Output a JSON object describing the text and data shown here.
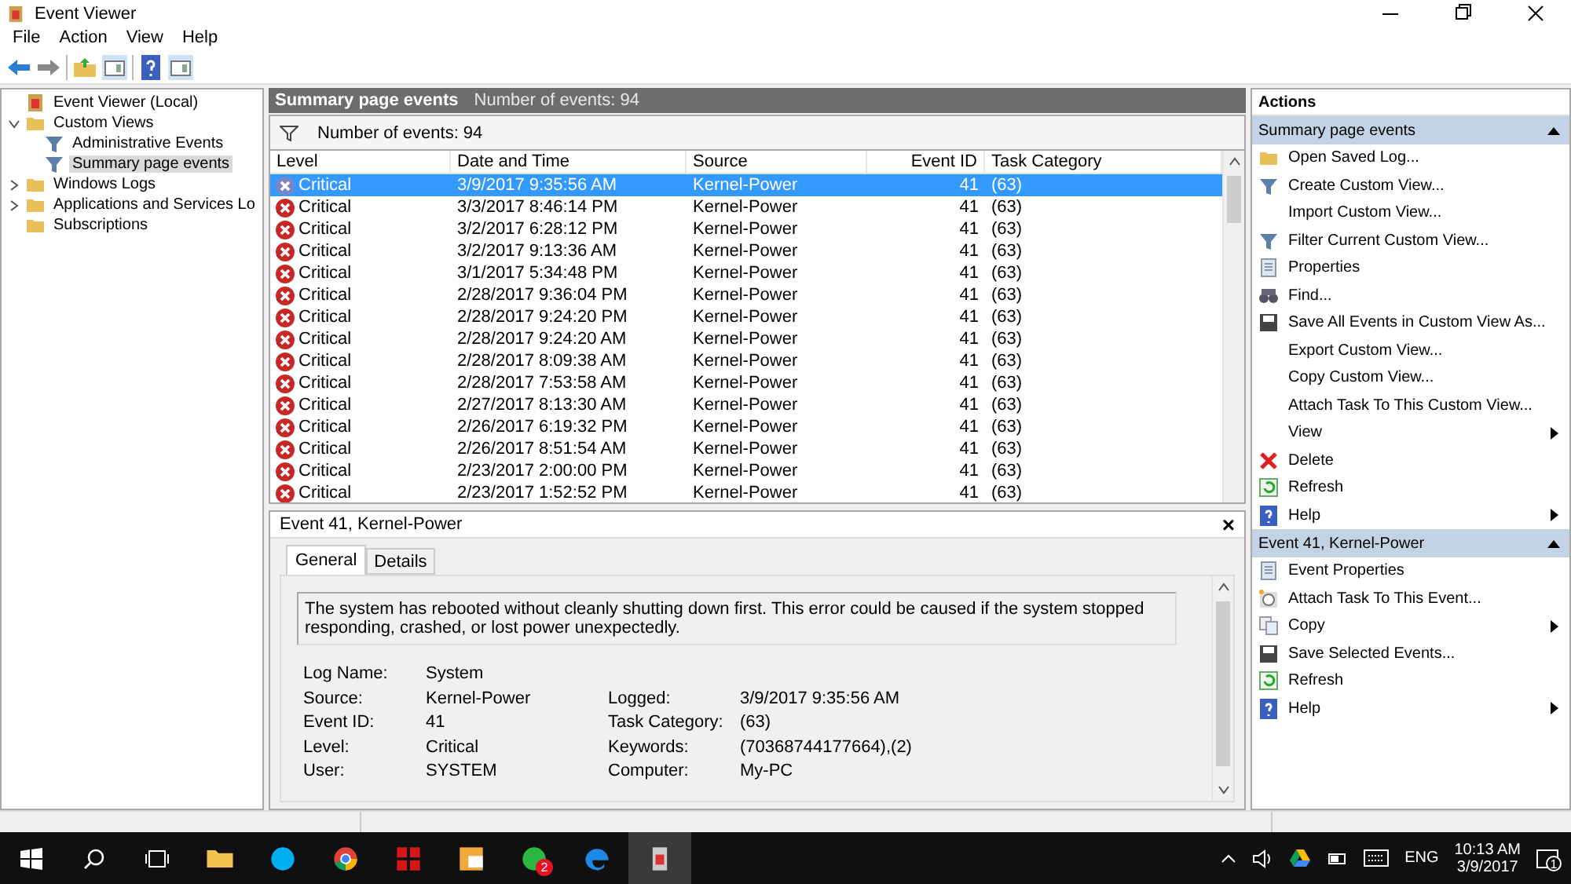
{
  "window": {
    "title": "Event Viewer"
  },
  "menu": [
    "File",
    "Action",
    "View",
    "Help"
  ],
  "toolbar": [
    {
      "kind": "back"
    },
    {
      "kind": "forward"
    },
    {
      "kind": "sep"
    },
    {
      "kind": "up"
    },
    {
      "kind": "pane"
    },
    {
      "kind": "sep"
    },
    {
      "kind": "help"
    },
    {
      "kind": "pane"
    }
  ],
  "tree": [
    {
      "label": "Event Viewer (Local)",
      "kind": "root",
      "selected": false,
      "children": [
        {
          "label": "Custom Views",
          "kind": "folder",
          "expanded": true,
          "selected": false,
          "children": [
            {
              "label": "Administrative Events",
              "kind": "filter",
              "selected": false
            },
            {
              "label": "Summary page events",
              "kind": "filter",
              "selected": true
            }
          ]
        },
        {
          "label": "Windows Logs",
          "kind": "folder",
          "expanded": false,
          "selected": false
        },
        {
          "label": "Applications and Services Lo",
          "kind": "folder",
          "expanded": false,
          "selected": false
        },
        {
          "label": "Subscriptions",
          "kind": "folder",
          "selected": false
        }
      ]
    }
  ],
  "header": {
    "title": "Summary page events",
    "count": "Number of events: 94"
  },
  "filter_bar": {
    "text": "Number of events: 94"
  },
  "table": {
    "columns": [
      "Level",
      "Date and Time",
      "Source",
      "Event ID",
      "Task Category"
    ],
    "rows": [
      {
        "level": "Critical",
        "date": "3/9/2017 9:35:56 AM",
        "source": "Kernel-Power",
        "id": "41",
        "category": "(63)",
        "selected": true
      },
      {
        "level": "Critical",
        "date": "3/3/2017 8:46:14 PM",
        "source": "Kernel-Power",
        "id": "41",
        "category": "(63)",
        "selected": false
      },
      {
        "level": "Critical",
        "date": "3/2/2017 6:28:12 PM",
        "source": "Kernel-Power",
        "id": "41",
        "category": "(63)",
        "selected": false
      },
      {
        "level": "Critical",
        "date": "3/2/2017 9:13:36 AM",
        "source": "Kernel-Power",
        "id": "41",
        "category": "(63)",
        "selected": false
      },
      {
        "level": "Critical",
        "date": "3/1/2017 5:34:48 PM",
        "source": "Kernel-Power",
        "id": "41",
        "category": "(63)",
        "selected": false
      },
      {
        "level": "Critical",
        "date": "2/28/2017 9:36:04 PM",
        "source": "Kernel-Power",
        "id": "41",
        "category": "(63)",
        "selected": false
      },
      {
        "level": "Critical",
        "date": "2/28/2017 9:24:20 PM",
        "source": "Kernel-Power",
        "id": "41",
        "category": "(63)",
        "selected": false
      },
      {
        "level": "Critical",
        "date": "2/28/2017 9:24:20 AM",
        "source": "Kernel-Power",
        "id": "41",
        "category": "(63)",
        "selected": false
      },
      {
        "level": "Critical",
        "date": "2/28/2017 8:09:38 AM",
        "source": "Kernel-Power",
        "id": "41",
        "category": "(63)",
        "selected": false
      },
      {
        "level": "Critical",
        "date": "2/28/2017 7:53:58 AM",
        "source": "Kernel-Power",
        "id": "41",
        "category": "(63)",
        "selected": false
      },
      {
        "level": "Critical",
        "date": "2/27/2017 8:13:30 AM",
        "source": "Kernel-Power",
        "id": "41",
        "category": "(63)",
        "selected": false
      },
      {
        "level": "Critical",
        "date": "2/26/2017 6:19:32 PM",
        "source": "Kernel-Power",
        "id": "41",
        "category": "(63)",
        "selected": false
      },
      {
        "level": "Critical",
        "date": "2/26/2017 8:51:54 AM",
        "source": "Kernel-Power",
        "id": "41",
        "category": "(63)",
        "selected": false
      },
      {
        "level": "Critical",
        "date": "2/23/2017 2:00:00 PM",
        "source": "Kernel-Power",
        "id": "41",
        "category": "(63)",
        "selected": false
      },
      {
        "level": "Critical",
        "date": "2/23/2017 1:52:52 PM",
        "source": "Kernel-Power",
        "id": "41",
        "category": "(63)",
        "selected": false
      }
    ]
  },
  "details": {
    "title": "Event 41, Kernel-Power",
    "close": "×",
    "tabs": [
      {
        "label": "General",
        "selected": true
      },
      {
        "label": "Details",
        "selected": false
      }
    ],
    "message": "The system has rebooted without cleanly shutting down first. This error could be caused if the system stopped responding, crashed, or lost power unexpectedly.",
    "fields": [
      {
        "left": {
          "label": "Log Name:",
          "value": "System"
        }
      },
      {
        "left": {
          "label": "Source:",
          "value": "Kernel-Power"
        },
        "right": {
          "label": "Logged:",
          "value": "3/9/2017 9:35:56 AM"
        }
      },
      {
        "left": {
          "label": "Event ID:",
          "value": "41"
        },
        "right": {
          "label": "Task Category:",
          "value": "(63)"
        }
      },
      {
        "left": {
          "label": "Level:",
          "value": "Critical"
        },
        "right": {
          "label": "Keywords:",
          "value": "(70368744177664),(2)"
        }
      },
      {
        "left": {
          "label": "User:",
          "value": "SYSTEM"
        },
        "right": {
          "label": "Computer:",
          "value": "My-PC"
        }
      }
    ]
  },
  "actions": {
    "title": "Actions",
    "sections": [
      {
        "title": "Summary page events",
        "expanded": true,
        "items": [
          {
            "label": "Open Saved Log...",
            "kind": "folder"
          },
          {
            "label": "Create Custom View...",
            "kind": "filter"
          },
          {
            "label": "Import Custom View...",
            "kind": "none"
          },
          {
            "label": "Filter Current Custom View...",
            "kind": "filter"
          },
          {
            "label": "Properties",
            "kind": "properties"
          },
          {
            "label": "Find...",
            "kind": "find"
          },
          {
            "label": "Save All Events in Custom View As...",
            "kind": "save"
          },
          {
            "label": "Export Custom View...",
            "kind": "none"
          },
          {
            "label": "Copy Custom View...",
            "kind": "none"
          },
          {
            "label": "Attach Task To This Custom View...",
            "kind": "none"
          },
          {
            "label": "View",
            "kind": "submenu"
          },
          {
            "label": "Delete",
            "kind": "delete"
          },
          {
            "label": "Refresh",
            "kind": "refresh"
          },
          {
            "label": "Help",
            "kind": "helpmenu"
          }
        ]
      },
      {
        "title": "Event 41, Kernel-Power",
        "expanded": true,
        "items": [
          {
            "label": "Event Properties",
            "kind": "properties"
          },
          {
            "label": "Attach Task To This Event...",
            "kind": "task"
          },
          {
            "label": "Copy",
            "kind": "copymenu"
          },
          {
            "label": "Save Selected Events...",
            "kind": "save"
          },
          {
            "label": "Refresh",
            "kind": "refresh"
          },
          {
            "label": "Help",
            "kind": "helpmenu"
          }
        ]
      }
    ]
  },
  "taskbar": {
    "apps": [
      {
        "kind": "explorer"
      },
      {
        "kind": "skype"
      },
      {
        "kind": "chrome"
      },
      {
        "kind": "redapp"
      },
      {
        "kind": "outlook"
      },
      {
        "kind": "whatsapp",
        "badge": "2"
      },
      {
        "kind": "edge"
      },
      {
        "kind": "eventviewer"
      }
    ],
    "language": "ENG",
    "time": "10:13 AM",
    "date": "3/9/2017",
    "notifications": "1"
  }
}
